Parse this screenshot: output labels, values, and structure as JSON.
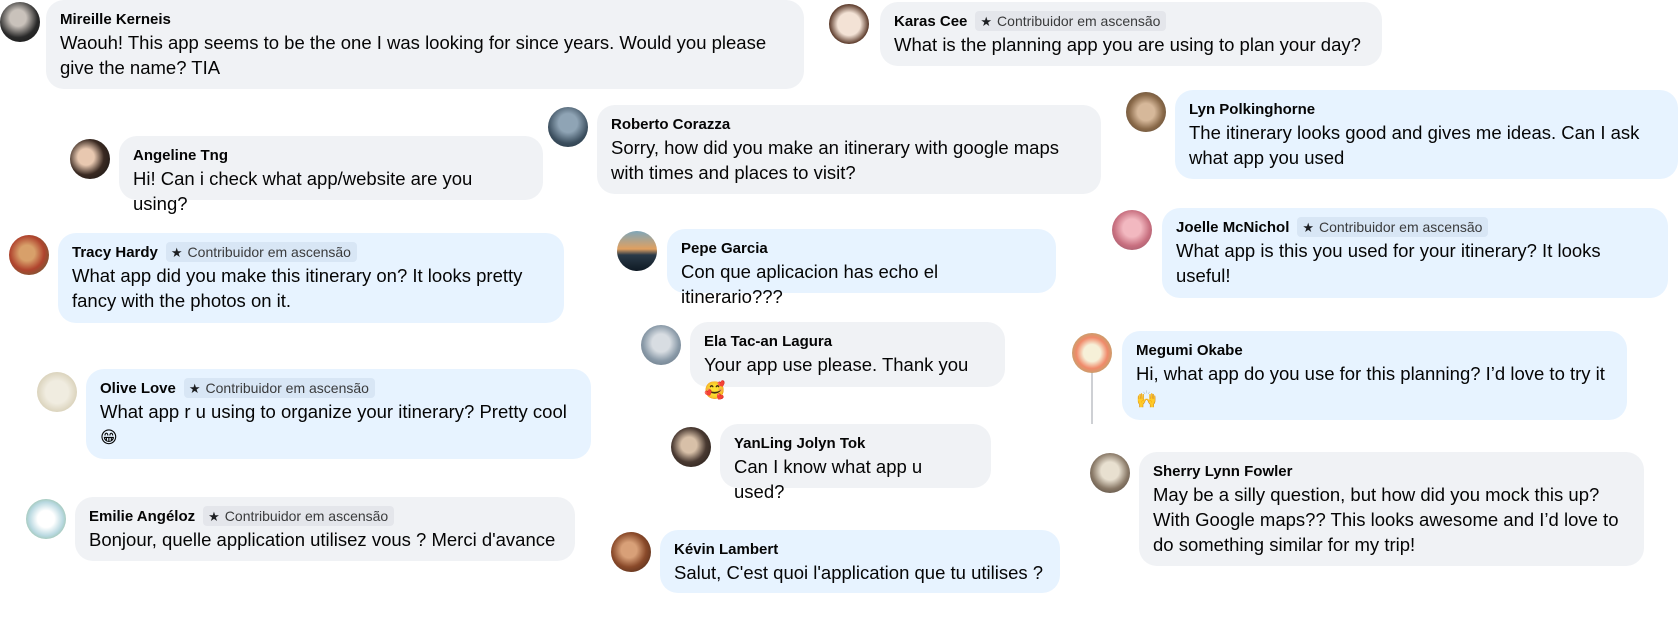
{
  "badge_label": "Contribuidor em ascensão",
  "comments": [
    {
      "name": "Mireille Kerneis",
      "text": "Waouh! This app seems to be the one I was looking for since years. Would you please give the name? TIA"
    },
    {
      "name": "Karas Cee",
      "badge": true,
      "text": "What is the planning app you are using to plan your day?"
    },
    {
      "name": "Angeline Tng",
      "text": "Hi! Can i check what app/website are you using?"
    },
    {
      "name": "Roberto Corazza",
      "text": "Sorry, how did you make an itinerary with google maps with times and places to visit?"
    },
    {
      "name": "Lyn Polkinghorne",
      "text": "The itinerary looks good and gives me ideas. Can I ask what app you used"
    },
    {
      "name": "Tracy Hardy",
      "badge": true,
      "text": "What app did you make this itinerary on? It looks pretty fancy with the photos on it."
    },
    {
      "name": "Pepe Garcia",
      "text": "Con que aplicacion has echo el itinerario???"
    },
    {
      "name": "Joelle McNichol",
      "badge": true,
      "text": "What app is this you used for your itinerary? It looks useful!"
    },
    {
      "name": "Ela Tac-an Lagura",
      "text": "Your app use please. Thank you",
      "emoji": "🥰"
    },
    {
      "name": "Megumi Okabe",
      "text": "Hi, what app do you use for this planning? I’d love to try it",
      "emoji": "🙌"
    },
    {
      "name": "Olive Love",
      "badge": true,
      "text": "What app r u using to organize your itinerary? Pretty cool",
      "emoji": "😁"
    },
    {
      "name": "YanLing Jolyn Tok",
      "text": "Can I know what app u used?"
    },
    {
      "name": "Sherry Lynn Fowler",
      "text": "May be a silly question, but how did you mock this up? With Google maps?? This looks awesome and I’d love to do something similar for my trip!"
    },
    {
      "name": "Emilie Angéloz",
      "badge": true,
      "text": "Bonjour, quelle application utilisez vous ? Merci d'avance"
    },
    {
      "name": "Kévin Lambert",
      "text": "Salut, C'est quoi l'application que tu utilises ?"
    }
  ],
  "colors": {
    "bubble_grey": "#f0f2f5",
    "bubble_blue": "#e7f3ff",
    "badge_bg": "#e4e6eb"
  }
}
